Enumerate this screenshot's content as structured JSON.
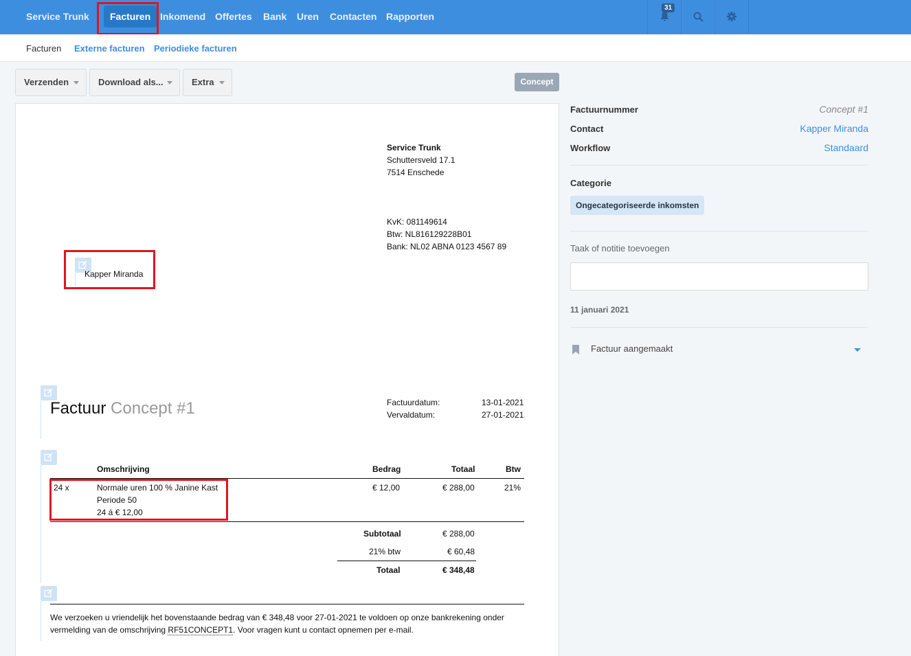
{
  "nav": {
    "brand": "Service Trunk",
    "items": [
      "Facturen",
      "Inkomend",
      "Offertes",
      "Bank",
      "Uren",
      "Contacten",
      "Rapporten"
    ],
    "notification_count": "31",
    "icons": [
      "bell-icon",
      "search-icon",
      "gear-icon"
    ]
  },
  "subnav": {
    "items": [
      "Facturen",
      "Externe facturen",
      "Periodieke facturen"
    ]
  },
  "toolbar": {
    "send_label": "Verzenden",
    "download_label": "Download als...",
    "extra_label": "Extra",
    "status": "Concept"
  },
  "invoice": {
    "company": {
      "name": "Service Trunk",
      "street": "Schuttersveld 17.1",
      "city": "7514 Enschede",
      "kvk": "KvK: 081149614",
      "btw": "Btw: NL816129228B01",
      "bank": "Bank: NL02 ABNA 0123 4567 89"
    },
    "recipient": "Kapper Miranda",
    "title_prefix": "Factuur",
    "title_ref": "Concept #1",
    "dates": {
      "invoice_date_label": "Factuurdatum:",
      "invoice_date": "13-01-2021",
      "due_date_label": "Vervaldatum:",
      "due_date": "27-01-2021"
    },
    "table": {
      "headers": {
        "description": "Omschrijving",
        "amount": "Bedrag",
        "total": "Totaal",
        "vat": "Btw"
      },
      "rows": [
        {
          "qty": "24 x",
          "line1": "Normale uren 100 % Janine Kast",
          "line2": "Periode 50",
          "line3": "24 á € 12,00",
          "amount": "€ 12,00",
          "total": "€ 288,00",
          "vat": "21%"
        }
      ]
    },
    "totals": {
      "subtotal_label": "Subtotaal",
      "subtotal": "€ 288,00",
      "vat_label": "21% btw",
      "vat": "€ 60,48",
      "total_label": "Totaal",
      "total": "€ 348,48"
    },
    "footer": {
      "line1": "We verzoeken u vriendelijk het bovenstaande bedrag van € 348,48 voor 27-01-2021 te voldoen op onze bankrekening onder",
      "line2_prefix": "vermelding van de omschrijving ",
      "reference": "RF51CONCEPT1",
      "line2_suffix": ". Voor vragen kunt u contact opnemen per e-mail."
    }
  },
  "sidebar": {
    "invoice_number_label": "Factuurnummer",
    "invoice_number": "Concept #1",
    "contact_label": "Contact",
    "contact": "Kapper Miranda",
    "workflow_label": "Workflow",
    "workflow": "Standaard",
    "category_label": "Categorie",
    "category": "Ongecategoriseerde inkomsten",
    "note_label": "Taak of notitie toevoegen",
    "date": "11 januari 2021",
    "event": "Factuur aangemaakt"
  },
  "colors": {
    "primary": "#3e8ee0",
    "highlight": "#e1141f"
  }
}
